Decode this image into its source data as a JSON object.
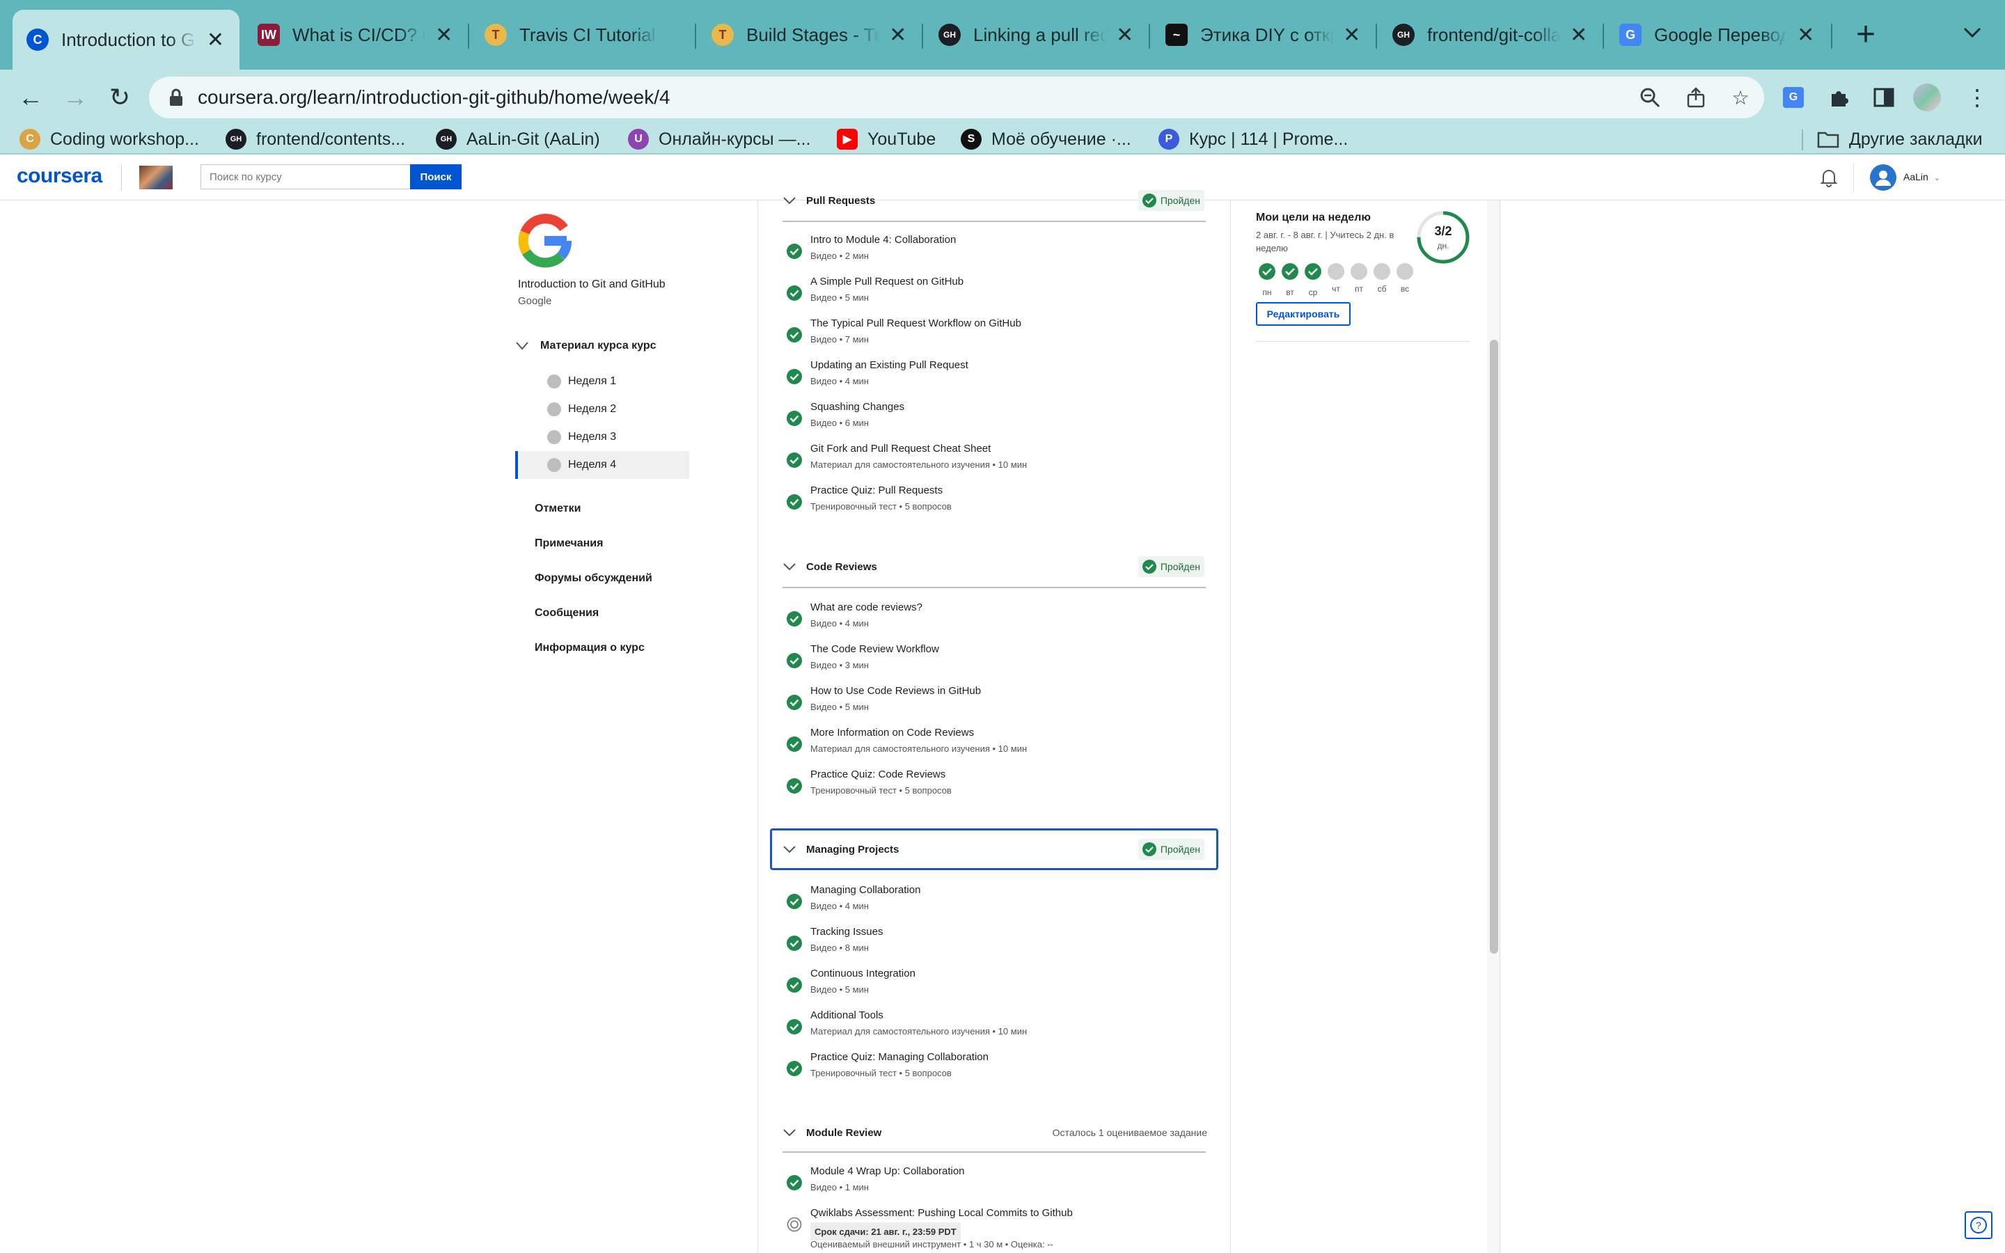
{
  "browser": {
    "tabs": [
      {
        "title": "Introduction to Git and GitHub",
        "fav_color": "#0056d2",
        "fav_text": "C"
      },
      {
        "title": "What is CI/CD? Continuous",
        "fav_color": "#8c1c3a",
        "fav_text": "IW"
      },
      {
        "title": "Travis CI Tutorial - Java",
        "fav_color": "#e8b84a",
        "fav_text": "T"
      },
      {
        "title": "Build Stages - Travis CI",
        "fav_color": "#e8b84a",
        "fav_text": "T"
      },
      {
        "title": "Linking a pull request",
        "fav_color": "#1b1f23",
        "fav_text": "GH"
      },
      {
        "title": "Этика DIY с открытым",
        "fav_color": "#111111",
        "fav_text": "~"
      },
      {
        "title": "frontend/git-collab",
        "fav_color": "#1b1f23",
        "fav_text": "GH"
      },
      {
        "title": "Google Переводчик",
        "fav_color": "#4285f4",
        "fav_text": "G"
      }
    ],
    "url": "coursera.org/learn/introduction-git-github/home/week/4",
    "bookmarks": [
      {
        "label": "Coding workshop...",
        "color": "#d9a441",
        "icon": "C"
      },
      {
        "label": "frontend/contents...",
        "color": "#1b1f23",
        "icon": "GH"
      },
      {
        "label": "AaLin-Git (AaLin)",
        "color": "#1b1f23",
        "icon": "GH"
      },
      {
        "label": "Онлайн-курсы —...",
        "color": "#8e44ad",
        "icon": "U"
      },
      {
        "label": "YouTube",
        "color": "#ff0000",
        "icon": "▶"
      },
      {
        "label": "Моё обучение ·...",
        "color": "#111111",
        "icon": "S"
      },
      {
        "label": "Курс | 114 | Prome...",
        "color": "#3b5bdb",
        "icon": "P"
      }
    ],
    "other_bookmarks": "Другие закладки"
  },
  "header": {
    "logo": "coursera",
    "search_placeholder": "Поиск по курсу",
    "search_button": "Поиск",
    "username": "AaLin"
  },
  "sidebar": {
    "course_title": "Introduction to Git and GitHub",
    "course_org": "Google",
    "material_label": "Материал курса курс",
    "weeks": [
      "Неделя 1",
      "Неделя 2",
      "Неделя 3",
      "Неделя 4"
    ],
    "selected_week": 3,
    "links": [
      "Отметки",
      "Примечания",
      "Форумы обсуждений",
      "Сообщения",
      "Информация о курс"
    ]
  },
  "sections": [
    {
      "title": "Pull Requests",
      "status": "Пройден",
      "items": [
        {
          "title": "Intro to Module 4: Collaboration",
          "meta": "Видео • 2 мин"
        },
        {
          "title": "A Simple Pull Request on GitHub",
          "meta": "Видео • 5 мин"
        },
        {
          "title": "The Typical Pull Request Workflow on GitHub",
          "meta": "Видео • 7 мин"
        },
        {
          "title": "Updating an Existing Pull Request",
          "meta": "Видео • 4 мин"
        },
        {
          "title": "Squashing Changes",
          "meta": "Видео • 6 мин"
        },
        {
          "title": "Git Fork and Pull Request Cheat Sheet",
          "meta": "Материал для самостоятельного изучения • 10 мин"
        },
        {
          "title": "Practice Quiz: Pull Requests",
          "meta": "Тренировочный тест • 5 вопросов"
        }
      ]
    },
    {
      "title": "Code Reviews",
      "status": "Пройден",
      "items": [
        {
          "title": "What are code reviews?",
          "meta": "Видео • 4 мин"
        },
        {
          "title": "The Code Review Workflow",
          "meta": "Видео • 3 мин"
        },
        {
          "title": "How to Use Code Reviews in GitHub",
          "meta": "Видео • 5 мин"
        },
        {
          "title": "More Information on Code Reviews",
          "meta": "Материал для самостоятельного изучения • 10 мин"
        },
        {
          "title": "Practice Quiz: Code Reviews",
          "meta": "Тренировочный тест • 5 вопросов"
        }
      ]
    },
    {
      "title": "Managing Projects",
      "status": "Пройден",
      "items": [
        {
          "title": "Managing Collaboration",
          "meta": "Видео • 4 мин"
        },
        {
          "title": "Tracking Issues",
          "meta": "Видео • 8 мин"
        },
        {
          "title": "Continuous Integration",
          "meta": "Видео • 5 мин"
        },
        {
          "title": "Additional Tools",
          "meta": "Материал для самостоятельного изучения • 10 мин"
        },
        {
          "title": "Practice Quiz: Managing Collaboration",
          "meta": "Тренировочный тест • 5 вопросов"
        }
      ]
    },
    {
      "title": "Module Review",
      "remaining": "Осталось 1 оцениваемое задание",
      "items": [
        {
          "title": "Module 4 Wrap Up: Collaboration",
          "meta": "Видео • 1 мин"
        },
        {
          "title": "Qwiklabs Assessment: Pushing Local Commits to Github",
          "deadline": "Срок сдачи: 21 авг. г., 23:59 PDT",
          "meta": "Оцениваемый внешний инструмент • 1 ч 30 м • Оценка: --"
        }
      ]
    }
  ],
  "goals": {
    "title": "Мои цели на неделю",
    "subtitle": "2 авг. г. - 8 авг. г. | Учитесь 2 дн. в неделю",
    "progress": "3/2",
    "progress_unit": "дн.",
    "days": [
      "пн",
      "вт",
      "ср",
      "чт",
      "пт",
      "сб",
      "вс"
    ],
    "days_done": [
      true,
      true,
      true,
      false,
      false,
      false,
      false
    ],
    "edit_button": "Редактировать"
  },
  "colors": {
    "accent": "#0056d2",
    "success": "#1f8a4c",
    "chrome_tabs": "#5fb6bb",
    "chrome_toolbar": "#bfe4e5"
  }
}
